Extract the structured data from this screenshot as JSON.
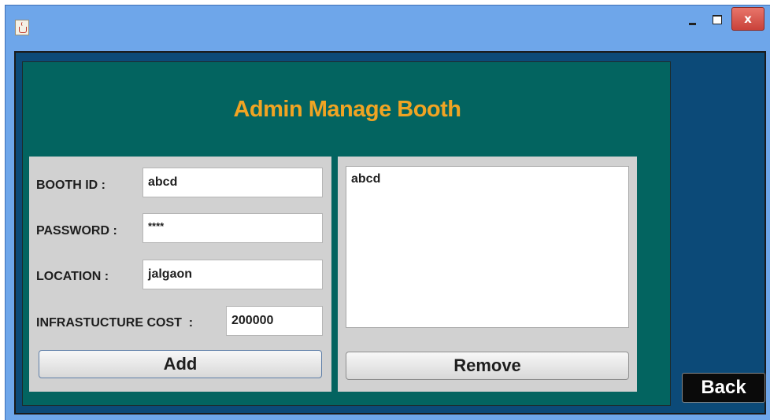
{
  "window": {
    "icons": {
      "app": "java-cup-icon",
      "minimize": "minimize-icon",
      "maximize": "maximize-icon",
      "close": "close-icon"
    },
    "close_label": "x"
  },
  "page": {
    "title": "Admin Manage Booth",
    "colors": {
      "title": "#f0a423",
      "panel": "#036460",
      "background": "#0c4a78",
      "titlebar": "#6ea6ea"
    }
  },
  "form": {
    "booth_id": {
      "label": "BOOTH ID :",
      "value": "abcd"
    },
    "password": {
      "label": "PASSWORD :",
      "value": "****"
    },
    "location": {
      "label": "LOCATION :",
      "value": "jalgaon"
    },
    "infra_cost": {
      "label": "INFRASTUCTURE COST  :",
      "value": "200000"
    },
    "add_label": "Add"
  },
  "booth_list": {
    "items": [
      "abcd"
    ],
    "remove_label": "Remove"
  },
  "back_label": "Back"
}
